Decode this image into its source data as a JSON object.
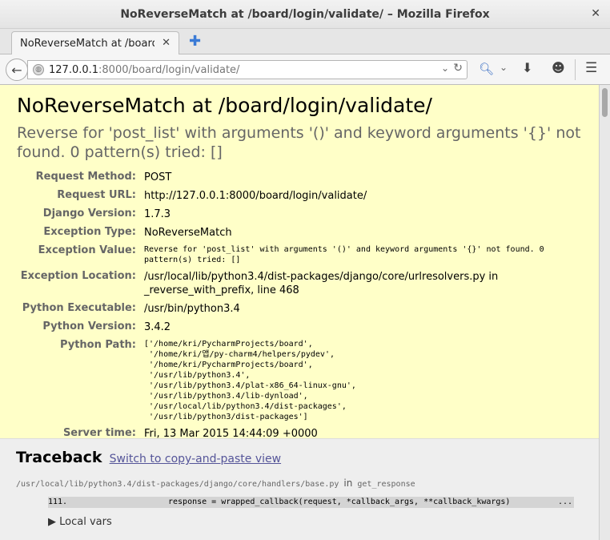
{
  "window": {
    "title": "NoReverseMatch at /board/login/validate/ – Mozilla Firefox"
  },
  "tab": {
    "label": "NoReverseMatch at /board/login/validate/"
  },
  "navbar": {
    "url_host": "127.0.0.1",
    "url_rest": ":8000/board/login/validate/"
  },
  "summary": {
    "title": "NoReverseMatch at /board/login/validate/",
    "message": "Reverse for 'post_list' with arguments '()' and keyword arguments '{}' not found. 0 pattern(s) tried: []",
    "rows": [
      {
        "label": "Request Method:",
        "value": "POST"
      },
      {
        "label": "Request URL:",
        "value": "http://127.0.0.1:8000/board/login/validate/"
      },
      {
        "label": "Django Version:",
        "value": "1.7.3"
      },
      {
        "label": "Exception Type:",
        "value": "NoReverseMatch"
      },
      {
        "label": "Exception Value:",
        "value": "Reverse for 'post_list' with arguments '()' and keyword arguments '{}' not found. 0\npattern(s) tried: []"
      },
      {
        "label": "Exception Location:",
        "value": "/usr/local/lib/python3.4/dist-packages/django/core/urlresolvers.py in _reverse_with_prefix, line 468"
      },
      {
        "label": "Python Executable:",
        "value": "/usr/bin/python3.4"
      },
      {
        "label": "Python Version:",
        "value": "3.4.2"
      },
      {
        "label": "Python Path:",
        "value": "['/home/kri/PycharmProjects/board',\n '/home/kri/앱/py-charm4/helpers/pydev',\n '/home/kri/PycharmProjects/board',\n '/usr/lib/python3.4',\n '/usr/lib/python3.4/plat-x86_64-linux-gnu',\n '/usr/lib/python3.4/lib-dynload',\n '/usr/local/lib/python3.4/dist-packages',\n '/usr/lib/python3/dist-packages']"
      },
      {
        "label": "Server time:",
        "value": "Fri, 13 Mar 2015 14:44:09 +0000"
      }
    ]
  },
  "traceback": {
    "heading": "Traceback",
    "copy_link": "Switch to copy-and-paste view",
    "frame_path": "/usr/local/lib/python3.4/dist-packages/django/core/handlers/base.py",
    "frame_in": "in",
    "frame_func": "get_response",
    "line_no": "111.",
    "code": "response = wrapped_callback(request, *callback_args, **callback_kwargs)",
    "ellipsis": "...",
    "local_vars": "▶ Local vars"
  }
}
